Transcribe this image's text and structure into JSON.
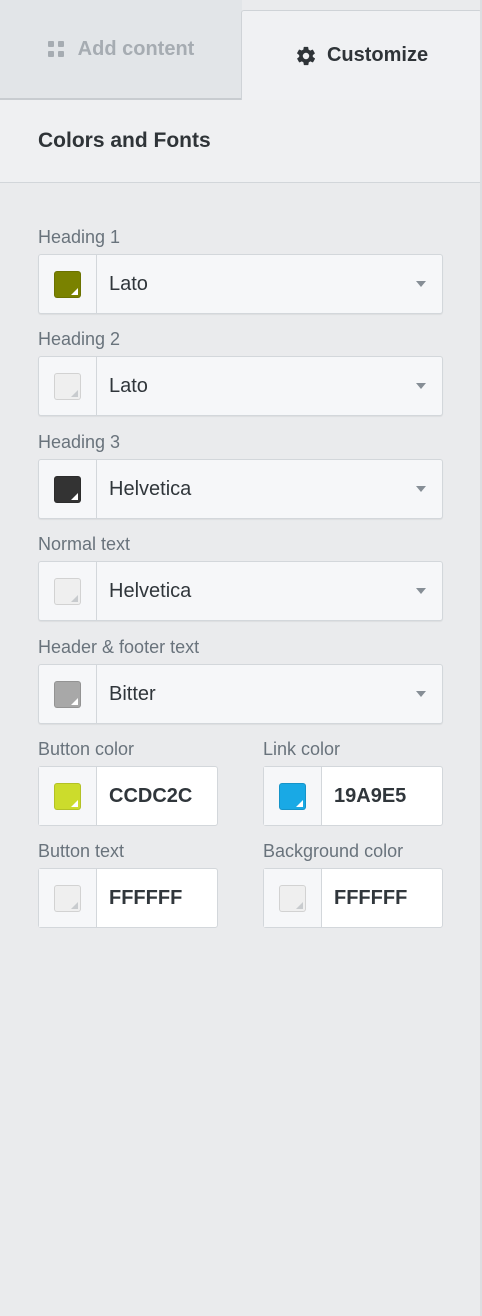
{
  "tabs": {
    "add_content": "Add content",
    "customize": "Customize",
    "active": "customize"
  },
  "section": {
    "title": "Colors and Fonts"
  },
  "font_fields": [
    {
      "label": "Heading 1",
      "font": "Lato",
      "color": "#7a8200"
    },
    {
      "label": "Heading 2",
      "font": "Lato",
      "color": "#efefef"
    },
    {
      "label": "Heading 3",
      "font": "Helvetica",
      "color": "#333333"
    },
    {
      "label": "Normal text",
      "font": "Helvetica",
      "color": "#efefef"
    },
    {
      "label": "Header & footer text",
      "font": "Bitter",
      "color": "#a8a8a8"
    }
  ],
  "color_fields": [
    {
      "label": "Button color",
      "value": "CCDC2C",
      "color": "#ccdc2c"
    },
    {
      "label": "Link color",
      "value": "19A9E5",
      "color": "#19a9e5"
    },
    {
      "label": "Button text",
      "value": "FFFFFF",
      "color": "#efefef"
    },
    {
      "label": "Background color",
      "value": "FFFFFF",
      "color": "#efefef"
    }
  ],
  "icons": {
    "add_content": "grid-icon",
    "customize": "gear-icon",
    "dropdown": "caret-down-icon"
  }
}
